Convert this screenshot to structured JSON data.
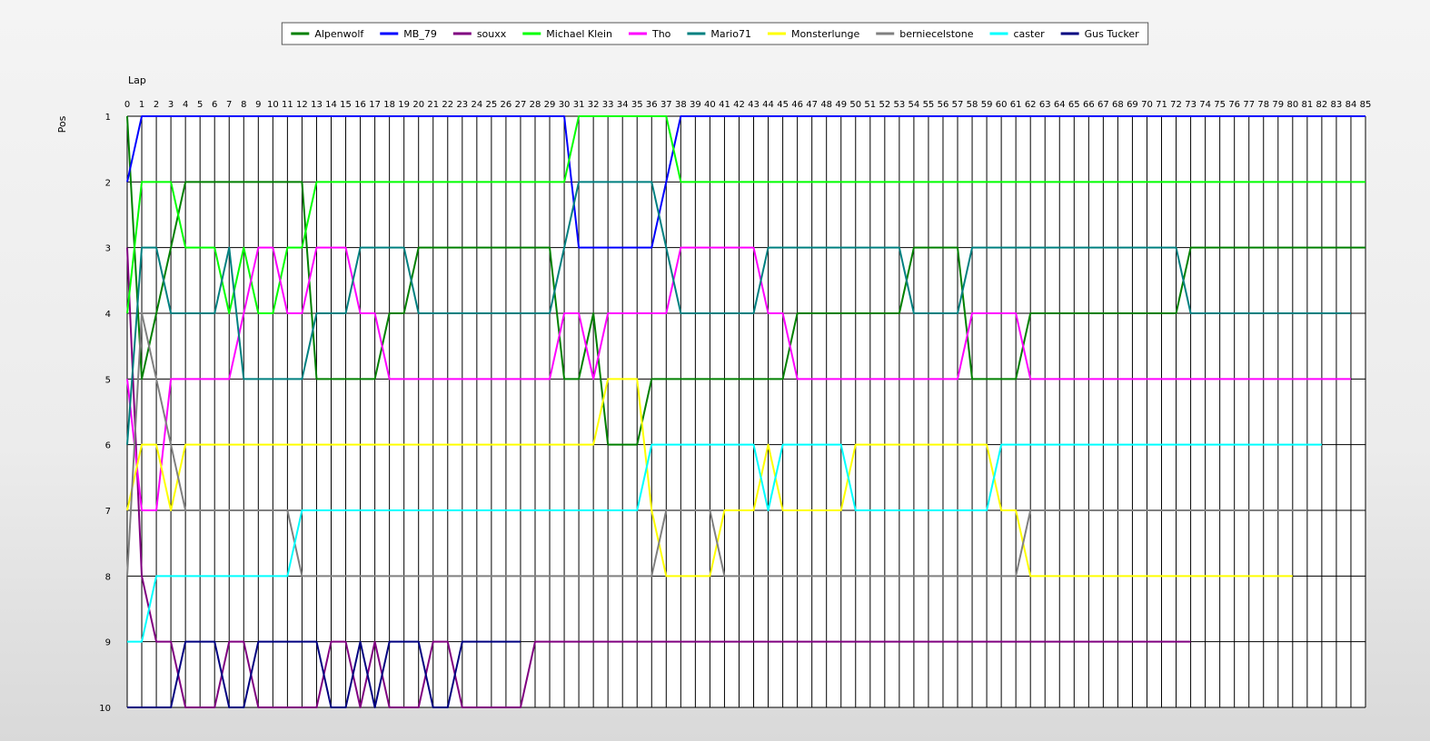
{
  "chart_data": {
    "type": "line",
    "title": "",
    "xlabel": "Lap",
    "ylabel": "Pos",
    "xlim": [
      0,
      85
    ],
    "ylim": [
      1,
      10
    ],
    "y_inverted": true,
    "grid": true,
    "legend_position": "top-center",
    "x_ticks": [
      0,
      1,
      2,
      3,
      4,
      5,
      6,
      7,
      8,
      9,
      10,
      11,
      12,
      13,
      14,
      15,
      16,
      17,
      18,
      19,
      20,
      21,
      22,
      23,
      24,
      25,
      26,
      27,
      28,
      29,
      30,
      31,
      32,
      33,
      34,
      35,
      36,
      37,
      38,
      39,
      40,
      41,
      42,
      43,
      44,
      45,
      46,
      47,
      48,
      49,
      50,
      51,
      52,
      53,
      54,
      55,
      56,
      57,
      58,
      59,
      60,
      61,
      62,
      63,
      64,
      65,
      66,
      67,
      68,
      69,
      70,
      71,
      72,
      73,
      74,
      75,
      76,
      77,
      78,
      79,
      80,
      81,
      82,
      83,
      84,
      85
    ],
    "y_ticks": [
      1,
      2,
      3,
      4,
      5,
      6,
      7,
      8,
      9,
      10
    ],
    "series": [
      {
        "name": "Alpenwolf",
        "color": "#008000",
        "points": [
          [
            0,
            1
          ],
          [
            1,
            5
          ],
          [
            4,
            2
          ],
          [
            12,
            2
          ],
          [
            13,
            5
          ],
          [
            17,
            5
          ],
          [
            18,
            4
          ],
          [
            19,
            4
          ],
          [
            20,
            3
          ],
          [
            29,
            3
          ],
          [
            30,
            5
          ],
          [
            31,
            5
          ],
          [
            32,
            4
          ],
          [
            33,
            6
          ],
          [
            35,
            6
          ],
          [
            36,
            5
          ],
          [
            45,
            5
          ],
          [
            46,
            4
          ],
          [
            53,
            4
          ],
          [
            54,
            3
          ],
          [
            57,
            3
          ],
          [
            58,
            5
          ],
          [
            61,
            5
          ],
          [
            62,
            4
          ],
          [
            72,
            4
          ],
          [
            73,
            3
          ],
          [
            85,
            3
          ]
        ]
      },
      {
        "name": "MB_79",
        "color": "#0000ff",
        "points": [
          [
            0,
            2
          ],
          [
            1,
            1
          ],
          [
            30,
            1
          ],
          [
            31,
            3
          ],
          [
            36,
            3
          ],
          [
            38,
            1
          ],
          [
            85,
            1
          ]
        ]
      },
      {
        "name": "souxx",
        "color": "#800080",
        "points": [
          [
            0,
            3
          ],
          [
            1,
            8
          ],
          [
            2,
            9
          ],
          [
            3,
            9
          ],
          [
            4,
            10
          ],
          [
            6,
            10
          ],
          [
            7,
            9
          ],
          [
            8,
            9
          ],
          [
            9,
            10
          ],
          [
            13,
            10
          ],
          [
            14,
            9
          ],
          [
            15,
            9
          ],
          [
            16,
            10
          ],
          [
            17,
            9
          ],
          [
            18,
            10
          ],
          [
            20,
            10
          ],
          [
            21,
            9
          ],
          [
            22,
            9
          ],
          [
            23,
            10
          ],
          [
            27,
            10
          ],
          [
            28,
            9
          ],
          [
            73,
            9
          ]
        ]
      },
      {
        "name": "Michael Klein",
        "color": "#00ff00",
        "points": [
          [
            0,
            4
          ],
          [
            1,
            2
          ],
          [
            3,
            2
          ],
          [
            4,
            3
          ],
          [
            6,
            3
          ],
          [
            7,
            4
          ],
          [
            8,
            3
          ],
          [
            9,
            4
          ],
          [
            10,
            4
          ],
          [
            11,
            3
          ],
          [
            12,
            3
          ],
          [
            13,
            2
          ],
          [
            30,
            2
          ],
          [
            31,
            1
          ],
          [
            37,
            1
          ],
          [
            38,
            2
          ],
          [
            85,
            2
          ]
        ]
      },
      {
        "name": "Tho",
        "color": "#ff00ff",
        "points": [
          [
            0,
            5
          ],
          [
            1,
            7
          ],
          [
            2,
            7
          ],
          [
            3,
            5
          ],
          [
            7,
            5
          ],
          [
            9,
            3
          ],
          [
            10,
            3
          ],
          [
            11,
            4
          ],
          [
            12,
            4
          ],
          [
            13,
            3
          ],
          [
            15,
            3
          ],
          [
            16,
            4
          ],
          [
            17,
            4
          ],
          [
            18,
            5
          ],
          [
            29,
            5
          ],
          [
            30,
            4
          ],
          [
            31,
            4
          ],
          [
            32,
            5
          ],
          [
            33,
            4
          ],
          [
            37,
            4
          ],
          [
            38,
            3
          ],
          [
            43,
            3
          ],
          [
            44,
            4
          ],
          [
            45,
            4
          ],
          [
            46,
            5
          ],
          [
            57,
            5
          ],
          [
            58,
            4
          ],
          [
            61,
            4
          ],
          [
            62,
            5
          ],
          [
            84,
            5
          ]
        ]
      },
      {
        "name": "Mario71",
        "color": "#008080",
        "points": [
          [
            0,
            6
          ],
          [
            1,
            3
          ],
          [
            2,
            3
          ],
          [
            3,
            4
          ],
          [
            6,
            4
          ],
          [
            7,
            3
          ],
          [
            8,
            5
          ],
          [
            12,
            5
          ],
          [
            13,
            4
          ],
          [
            15,
            4
          ],
          [
            16,
            3
          ],
          [
            19,
            3
          ],
          [
            20,
            4
          ],
          [
            29,
            4
          ],
          [
            31,
            2
          ],
          [
            36,
            2
          ],
          [
            38,
            4
          ],
          [
            43,
            4
          ],
          [
            44,
            3
          ],
          [
            53,
            3
          ],
          [
            54,
            4
          ],
          [
            57,
            4
          ],
          [
            58,
            3
          ],
          [
            72,
            3
          ],
          [
            73,
            4
          ],
          [
            84,
            4
          ]
        ]
      },
      {
        "name": "Monsterlunge",
        "color": "#ffff00",
        "points": [
          [
            0,
            7
          ],
          [
            1,
            6
          ],
          [
            2,
            6
          ],
          [
            3,
            7
          ],
          [
            4,
            6
          ],
          [
            32,
            6
          ],
          [
            33,
            5
          ],
          [
            35,
            5
          ],
          [
            36,
            7
          ],
          [
            37,
            8
          ],
          [
            40,
            8
          ],
          [
            41,
            7
          ],
          [
            43,
            7
          ],
          [
            44,
            6
          ],
          [
            45,
            7
          ],
          [
            49,
            7
          ],
          [
            50,
            6
          ],
          [
            59,
            6
          ],
          [
            60,
            7
          ],
          [
            61,
            7
          ],
          [
            62,
            8
          ],
          [
            80,
            8
          ]
        ]
      },
      {
        "name": "berniecelstone",
        "color": "#808080",
        "points": [
          [
            0,
            8
          ],
          [
            1,
            4
          ],
          [
            4,
            7
          ],
          [
            11,
            7
          ],
          [
            12,
            8
          ],
          [
            36,
            8
          ],
          [
            37,
            7
          ],
          [
            40,
            7
          ],
          [
            41,
            8
          ],
          [
            61,
            8
          ],
          [
            62,
            7
          ],
          [
            81,
            7
          ]
        ]
      },
      {
        "name": "caster",
        "color": "#00ffff",
        "points": [
          [
            0,
            9
          ],
          [
            1,
            9
          ],
          [
            2,
            8
          ],
          [
            11,
            8
          ],
          [
            12,
            7
          ],
          [
            35,
            7
          ],
          [
            36,
            6
          ],
          [
            43,
            6
          ],
          [
            44,
            7
          ],
          [
            45,
            6
          ],
          [
            49,
            6
          ],
          [
            50,
            7
          ],
          [
            59,
            7
          ],
          [
            60,
            6
          ],
          [
            82,
            6
          ]
        ]
      },
      {
        "name": "Gus Tucker",
        "color": "#000080",
        "points": [
          [
            0,
            10
          ],
          [
            3,
            10
          ],
          [
            4,
            9
          ],
          [
            6,
            9
          ],
          [
            7,
            10
          ],
          [
            8,
            10
          ],
          [
            9,
            9
          ],
          [
            13,
            9
          ],
          [
            14,
            10
          ],
          [
            15,
            10
          ],
          [
            16,
            9
          ],
          [
            17,
            10
          ],
          [
            18,
            9
          ],
          [
            20,
            9
          ],
          [
            21,
            10
          ],
          [
            22,
            10
          ],
          [
            23,
            9
          ],
          [
            27,
            9
          ]
        ]
      }
    ]
  }
}
